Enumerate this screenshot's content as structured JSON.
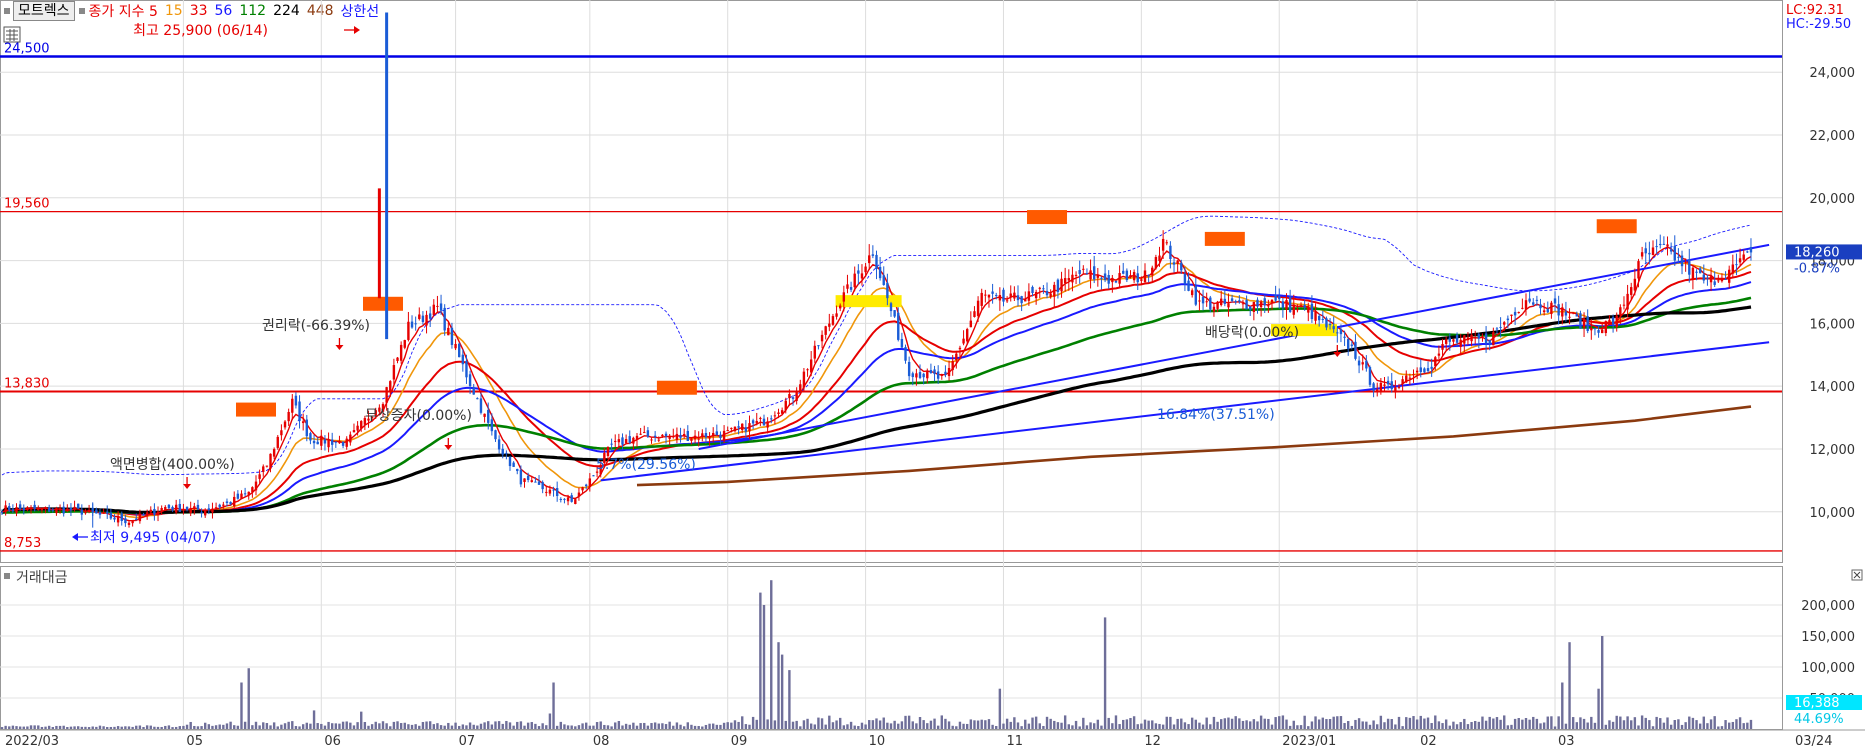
{
  "header": {
    "stock_name": "모트렉스",
    "indicator_label": "종가 지수 5",
    "ma_periods": [
      "15",
      "33",
      "56",
      "112",
      "224",
      "448"
    ],
    "ma_colors": [
      "#f0960a",
      "#e60000",
      "#1a1aff",
      "#008000",
      "#000000",
      "#8b3a0f"
    ],
    "upper_line_label": "상한선",
    "price_label_color": "#e60000",
    "lc": "LC:92.31",
    "hc": "HC:-29.50"
  },
  "volume_panel": {
    "title": "거래대금",
    "current_value": "16,388",
    "current_pct": "44.69%",
    "yticks": [
      {
        "v": 50000,
        "label": "50,000"
      },
      {
        "v": 100000,
        "label": "100,000"
      },
      {
        "v": 150000,
        "label": "150,000"
      },
      {
        "v": 200000,
        "label": "200,000"
      }
    ]
  },
  "chart_data": {
    "type": "candlestick",
    "price_axis": {
      "ylim": [
        8400,
        26300
      ],
      "ticks": [
        {
          "v": 10000,
          "label": "10,000"
        },
        {
          "v": 12000,
          "label": "12,000"
        },
        {
          "v": 14000,
          "label": "14,000"
        },
        {
          "v": 16000,
          "label": "16,000"
        },
        {
          "v": 18000,
          "label": "18,000"
        },
        {
          "v": 20000,
          "label": "20,000"
        },
        {
          "v": 22000,
          "label": "22,000"
        },
        {
          "v": 24000,
          "label": "24,000"
        }
      ]
    },
    "x_labels": [
      "2022/03",
      "05",
      "06",
      "07",
      "08",
      "09",
      "10",
      "11",
      "12",
      "2023/01",
      "02",
      "03",
      "03/24"
    ],
    "horizontal_levels": [
      {
        "value": 24500,
        "label": "24,500",
        "color": "#0000e6"
      },
      {
        "value": 19560,
        "label": "19,560",
        "color": "#e60000"
      },
      {
        "value": 13830,
        "label": "13,830",
        "color": "#e60000"
      },
      {
        "value": 8753,
        "label": "8,753",
        "color": "#e60000"
      }
    ],
    "current_price": {
      "value": 18260,
      "label": "18,260",
      "change": "-0.87%"
    },
    "annotations": {
      "high": "최고 25,900 (06/14)",
      "low": "최저 9,495 (04/07)",
      "split": "액면병합(400.00%)",
      "rights": "권리락(-66.39%)",
      "bonus": "무상증자(0.00%)",
      "pct1": "5.7%(29.56%)",
      "pct2": "16.84%(37.51%)",
      "dividend": "배당락(0.00%)"
    },
    "price_anchor_days": [
      0,
      20,
      35,
      45,
      55,
      62,
      68,
      73,
      80,
      85,
      95,
      105,
      112,
      120,
      135,
      143,
      150,
      157,
      162,
      168,
      175,
      190,
      200,
      210,
      218,
      230,
      240,
      250,
      260,
      270,
      275,
      285,
      290,
      297,
      305,
      315,
      320,
      330,
      342,
      350,
      360,
      372,
      378,
      382,
      388,
      394,
      398,
      410,
      420,
      430,
      438,
      445,
      452,
      458,
      465,
      470,
      478,
      482
    ],
    "price_anchor_values": [
      10100,
      10050,
      9700,
      10150,
      10050,
      10250,
      10600,
      11500,
      13500,
      12300,
      12200,
      13600,
      15900,
      16500,
      12500,
      11000,
      10700,
      10300,
      11000,
      12100,
      12400,
      12400,
      12500,
      12900,
      13700,
      16500,
      18300,
      14500,
      14200,
      16900,
      16700,
      16900,
      17100,
      17600,
      17400,
      17500,
      18600,
      16600,
      16600,
      16700,
      16400,
      15200,
      14000,
      13900,
      14400,
      14700,
      15400,
      15500,
      16800,
      16400,
      15800,
      16100,
      18100,
      18400,
      17700,
      17300,
      17800,
      18260
    ],
    "volume_spike_days": [
      {
        "d": 66,
        "v": 75000
      },
      {
        "d": 68,
        "v": 98000
      },
      {
        "d": 86,
        "v": 30000
      },
      {
        "d": 99,
        "v": 28000
      },
      {
        "d": 151,
        "v": 25000
      },
      {
        "d": 152,
        "v": 75000
      },
      {
        "d": 209,
        "v": 220000
      },
      {
        "d": 210,
        "v": 200000
      },
      {
        "d": 212,
        "v": 240000
      },
      {
        "d": 214,
        "v": 140000
      },
      {
        "d": 215,
        "v": 120000
      },
      {
        "d": 217,
        "v": 95000
      },
      {
        "d": 275,
        "v": 65000
      },
      {
        "d": 304,
        "v": 180000
      },
      {
        "d": 430,
        "v": 75000
      },
      {
        "d": 432,
        "v": 140000
      },
      {
        "d": 440,
        "v": 65000
      },
      {
        "d": 441,
        "v": 150000
      }
    ],
    "ma_anchor_values": {
      "448": [
        [
          175,
          10850
        ],
        [
          200,
          10950
        ],
        [
          250,
          11300
        ],
        [
          300,
          11750
        ],
        [
          350,
          12050
        ],
        [
          400,
          12400
        ],
        [
          450,
          12900
        ],
        [
          482,
          13350
        ]
      ]
    },
    "trendlines": [
      {
        "from": [
          192,
          12000
        ],
        "to": [
          487,
          18500
        ]
      },
      {
        "from": [
          165,
          11000
        ],
        "to": [
          487,
          15400
        ]
      }
    ],
    "resistance_markers": [
      70,
      105,
      186,
      288,
      337,
      445
    ],
    "support_markers": [
      238,
      358
    ]
  }
}
